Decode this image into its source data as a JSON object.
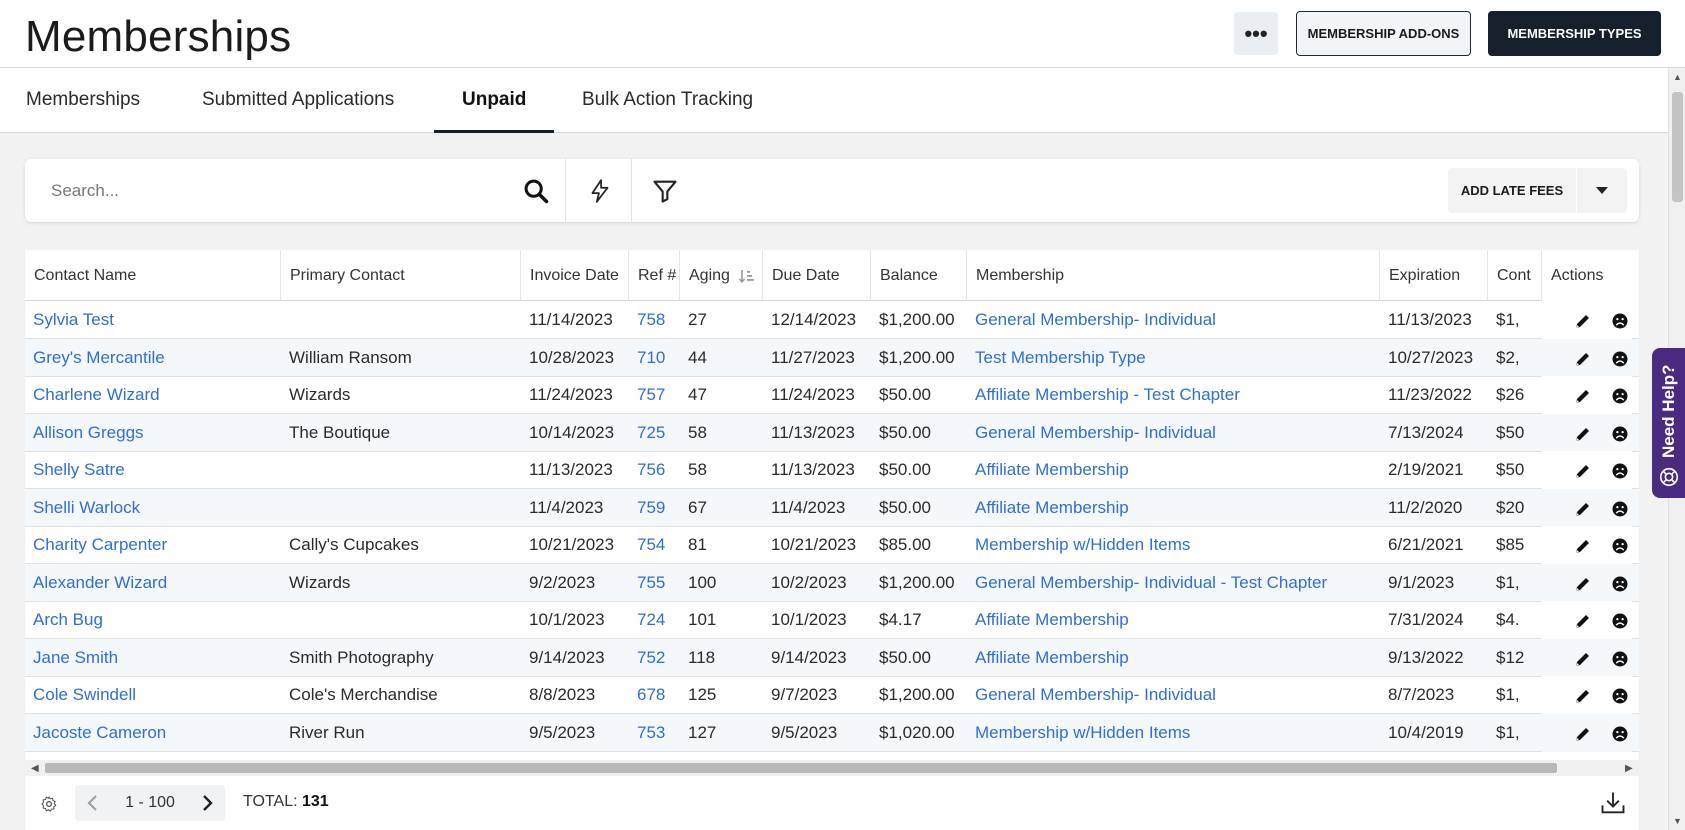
{
  "header": {
    "title": "Memberships",
    "more_label": "•••",
    "addons_label": "MEMBERSHIP ADD-ONS",
    "types_label": "MEMBERSHIP TYPES"
  },
  "tabs": [
    {
      "label": "Memberships"
    },
    {
      "label": "Submitted Applications"
    },
    {
      "label": "Unpaid",
      "active": true
    },
    {
      "label": "Bulk Action Tracking"
    }
  ],
  "toolbar": {
    "search_placeholder": "Search...",
    "late_fees_label": "ADD LATE FEES"
  },
  "table": {
    "columns": [
      "Contact Name",
      "Primary Contact",
      "Invoice Date",
      "Ref #",
      "Aging",
      "Due Date",
      "Balance",
      "Membership",
      "Expiration",
      "Cont",
      "Actions"
    ],
    "rows": [
      {
        "contact": "Sylvia Test",
        "primary": "",
        "invoice": "11/14/2023",
        "ref": "758",
        "aging": "27",
        "due": "12/14/2023",
        "balance": "$1,200.00",
        "membership": "General Membership- Individual",
        "expiration": "11/13/2023",
        "cont": "$1,"
      },
      {
        "contact": "Grey's Mercantile",
        "primary": "William Ransom",
        "invoice": "10/28/2023",
        "ref": "710",
        "aging": "44",
        "due": "11/27/2023",
        "balance": "$1,200.00",
        "membership": "Test Membership Type",
        "expiration": "10/27/2023",
        "cont": "$2,"
      },
      {
        "contact": "Charlene Wizard",
        "primary": "Wizards",
        "invoice": "11/24/2023",
        "ref": "757",
        "aging": "47",
        "due": "11/24/2023",
        "balance": "$50.00",
        "membership": "Affiliate Membership - Test Chapter",
        "expiration": "11/23/2022",
        "cont": "$26"
      },
      {
        "contact": "Allison Greggs",
        "primary": "The Boutique",
        "invoice": "10/14/2023",
        "ref": "725",
        "aging": "58",
        "due": "11/13/2023",
        "balance": "$50.00",
        "membership": "General Membership- Individual",
        "expiration": "7/13/2024",
        "cont": "$50"
      },
      {
        "contact": "Shelly Satre",
        "primary": "",
        "invoice": "11/13/2023",
        "ref": "756",
        "aging": "58",
        "due": "11/13/2023",
        "balance": "$50.00",
        "membership": "Affiliate Membership",
        "expiration": "2/19/2021",
        "cont": "$50"
      },
      {
        "contact": "Shelli Warlock",
        "primary": "",
        "invoice": "11/4/2023",
        "ref": "759",
        "aging": "67",
        "due": "11/4/2023",
        "balance": "$50.00",
        "membership": "Affiliate Membership",
        "expiration": "11/2/2020",
        "cont": "$20"
      },
      {
        "contact": "Charity Carpenter",
        "primary": "Cally's Cupcakes",
        "invoice": "10/21/2023",
        "ref": "754",
        "aging": "81",
        "due": "10/21/2023",
        "balance": "$85.00",
        "membership": "Membership w/Hidden Items",
        "expiration": "6/21/2021",
        "cont": "$85"
      },
      {
        "contact": "Alexander Wizard",
        "primary": "Wizards",
        "invoice": "9/2/2023",
        "ref": "755",
        "aging": "100",
        "due": "10/2/2023",
        "balance": "$1,200.00",
        "membership": "General Membership- Individual - Test Chapter",
        "expiration": "9/1/2023",
        "cont": "$1,"
      },
      {
        "contact": "Arch Bug",
        "primary": "",
        "invoice": "10/1/2023",
        "ref": "724",
        "aging": "101",
        "due": "10/1/2023",
        "balance": "$4.17",
        "membership": "Affiliate Membership",
        "expiration": "7/31/2024",
        "cont": "$4."
      },
      {
        "contact": "Jane Smith",
        "primary": "Smith Photography",
        "invoice": "9/14/2023",
        "ref": "752",
        "aging": "118",
        "due": "9/14/2023",
        "balance": "$50.00",
        "membership": "Affiliate Membership",
        "expiration": "9/13/2022",
        "cont": "$12"
      },
      {
        "contact": "Cole Swindell",
        "primary": "Cole's Merchandise",
        "invoice": "8/8/2023",
        "ref": "678",
        "aging": "125",
        "due": "9/7/2023",
        "balance": "$1,200.00",
        "membership": "General Membership- Individual",
        "expiration": "8/7/2023",
        "cont": "$1,"
      },
      {
        "contact": "Jacoste Cameron",
        "primary": "River Run",
        "invoice": "9/5/2023",
        "ref": "753",
        "aging": "127",
        "due": "9/5/2023",
        "balance": "$1,020.00",
        "membership": "Membership w/Hidden Items",
        "expiration": "10/4/2019",
        "cont": "$1,"
      }
    ]
  },
  "footer": {
    "page_range": "1 - 100",
    "total_label": "TOTAL:",
    "total_value": "131"
  },
  "help": {
    "label": "Need Help?"
  }
}
